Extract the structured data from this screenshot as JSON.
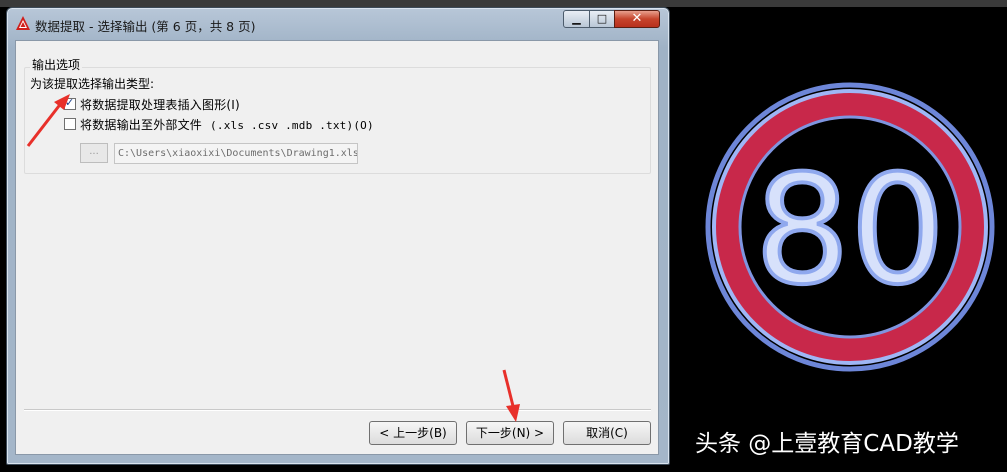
{
  "window": {
    "title": "数据提取 - 选择输出 (第 6 页，共 8 页)",
    "controls": {
      "minimize": "▁",
      "maximize": "□",
      "close": "✕"
    }
  },
  "output_options": {
    "group_label": "输出选项",
    "sub_label": "为该提取选择输出类型:",
    "insert_table": {
      "label": "将数据提取处理表插入图形(I)",
      "checked": true
    },
    "external_file": {
      "label": "将数据输出至外部文件",
      "hint": "(.xls .csv .mdb .txt)(O)",
      "checked": false
    },
    "browse_label": "...",
    "file_path": "C:\\Users\\xiaoxixi\\Documents\\Drawing1.xls"
  },
  "buttons": {
    "back": "< 上一步(B)",
    "next": "下一步(N) >",
    "cancel": "取消(C)"
  },
  "sign": {
    "text": "80",
    "ring_color": "#c8284a",
    "glow_color": "#8aa6f0"
  },
  "watermark": "头条 @上壹教育CAD教学",
  "colors": {
    "annotation_arrow": "#e8302a"
  }
}
